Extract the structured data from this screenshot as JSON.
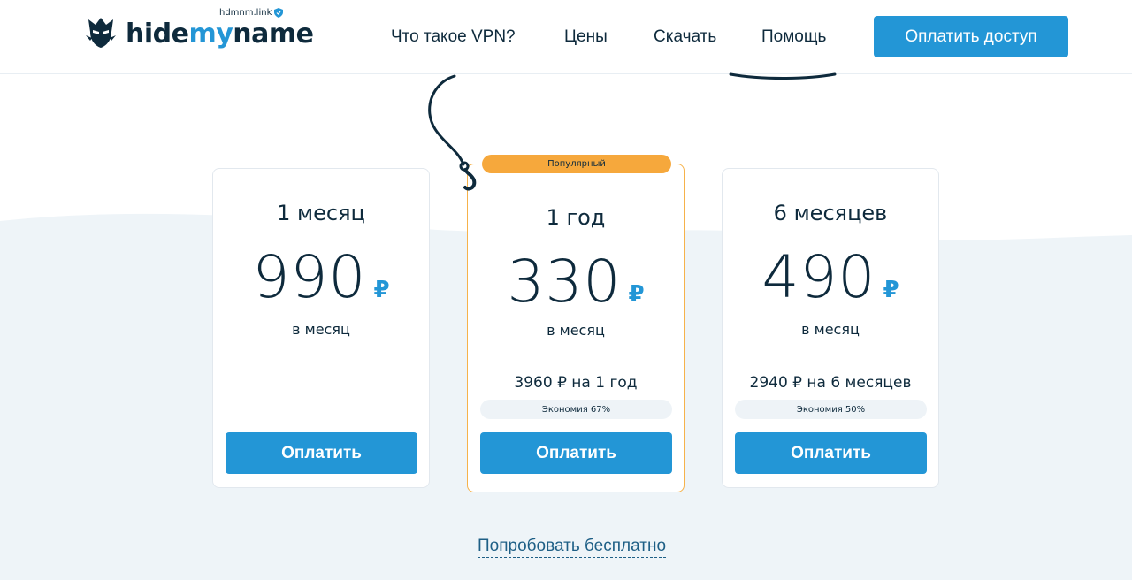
{
  "header": {
    "logo": {
      "hide": "hide",
      "my": "my",
      "name": "name",
      "domain": "hdmnm.link"
    },
    "nav": [
      {
        "label": "Что такое VPN?"
      },
      {
        "label": "Цены"
      },
      {
        "label": "Скачать"
      },
      {
        "label": "Помощь"
      }
    ],
    "cta_label": "Оплатить доступ"
  },
  "plans": [
    {
      "title": "1 месяц",
      "price": "990",
      "currency": "₽",
      "period": "в месяц",
      "total": "",
      "savings": "",
      "button": "Оплатить"
    },
    {
      "badge": "Популярный",
      "title": "1 год",
      "price": "330",
      "currency": "₽",
      "period": "в месяц",
      "total": "3960 ₽ на 1 год",
      "savings": "Экономия 67%",
      "button": "Оплатить"
    },
    {
      "title": "6 месяцев",
      "price": "490",
      "currency": "₽",
      "period": "в месяц",
      "total": "2940 ₽ на 6 месяцев",
      "savings": "Экономия 50%",
      "button": "Оплатить"
    }
  ],
  "try_free_label": "Попробовать бесплатно",
  "colors": {
    "accent": "#2396d6",
    "popular": "#f6a83c",
    "text": "#0e2a3c",
    "background_wave": "#eef4f8"
  }
}
